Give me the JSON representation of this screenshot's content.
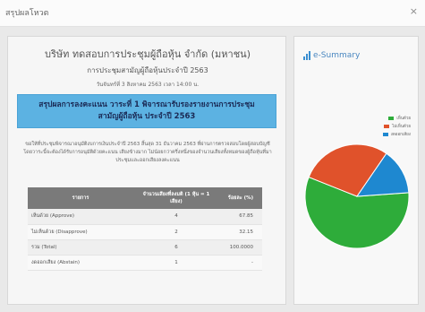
{
  "window": {
    "title": "สรุปผลโหวต",
    "close_glyph": "×"
  },
  "report": {
    "company": "บริษัท ทดสอบการประชุมผู้ถือหุ้น จำกัด (มหาชน)",
    "meeting": "การประชุมสามัญผู้ถือหุ้นประจำปี 2563",
    "datetime": "วันจันทร์ที่ 3 สิงหาคม 2563 เวลา 14:00 น.",
    "agenda": "สรุปผลการลงคะแนน วาระที่ 1 พิจารณารับรองรายงานการประชุมสามัญผู้ถือหุ้น ประจำปี 2563",
    "description": "ขอให้ที่ประชุมพิจารณาอนุมัติงบการเงินประจำปี 2563 สิ้นสุด 31 ธันวาคม 2563 ที่ผ่านการตรวจสอบโดยผู้สอบบัญชี โดยวาระนี้จะต้องได้รับการอนุมัติด้วยคะแนน เสียงข้างมาก ไม่น้อยกว่าครึ่งหนึ่งของจำนวนเสียงทั้งหมดของผู้ถือหุ้นที่มาประชุมและออกเสียงลงคะแนน"
  },
  "table": {
    "headers": [
      "รายการ",
      "จำนวนเสียงที่ลงมติ (1 หุ้น = 1 เสียง)",
      "ร้อยละ (%)"
    ],
    "rows": [
      {
        "label": "เห็นด้วย (Approve)",
        "votes": "4",
        "percent": "67.85"
      },
      {
        "label": "ไม่เห็นด้วย (Disapprove)",
        "votes": "2",
        "percent": "32.15"
      },
      {
        "label": "รวม (Total)",
        "votes": "6",
        "percent": "100.0000"
      },
      {
        "label": "งดออกเสียง (Abstain)",
        "votes": "1",
        "percent": "-"
      }
    ]
  },
  "summary": {
    "title": "e-Summary",
    "icon": "bar-chart-icon",
    "legend": [
      {
        "label": "เห็นด้วย",
        "color": "#2eac3a"
      },
      {
        "label": "ไม่เห็นด้วย",
        "color": "#e0522b"
      },
      {
        "label": "งดออกเสียง",
        "color": "#1e88d0"
      }
    ]
  },
  "chart_data": {
    "type": "pie",
    "categories": [
      "เห็นด้วย",
      "ไม่เห็นด้วย",
      "งดออกเสียง"
    ],
    "values": [
      4,
      2,
      1
    ],
    "colors": [
      "#2eac3a",
      "#e0522b",
      "#1e88d0"
    ]
  }
}
